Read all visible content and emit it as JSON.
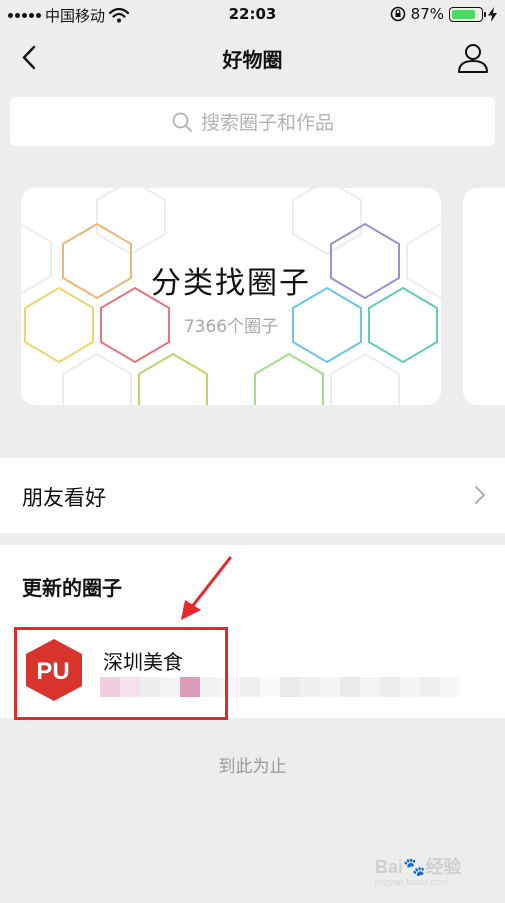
{
  "status_bar": {
    "carrier": "中国移动",
    "time": "22:03",
    "battery_percent": "87%",
    "battery_level": 0.87,
    "icons": [
      "signal-icon",
      "wifi-icon",
      "orientation-lock-icon",
      "battery-icon",
      "charging-icon"
    ]
  },
  "nav": {
    "title": "好物圈",
    "back_icon": "chevron-left-icon",
    "profile_icon": "person-icon"
  },
  "search": {
    "placeholder": "搜索圈子和作品",
    "icon": "search-icon"
  },
  "category_card": {
    "title": "分类找圈子",
    "count": "7366个圈子"
  },
  "friends": {
    "label": "朋友看好",
    "icon": "chevron-right-icon"
  },
  "updates": {
    "title": "更新的圈子",
    "items": [
      {
        "name": "深圳美食",
        "avatar_text": "PU",
        "avatar_color": "#d9342b"
      }
    ]
  },
  "footer": {
    "end_text": "到此为止"
  },
  "watermark": {
    "brand": "Bai",
    "brand_suffix": "经验",
    "url": "jingyan.baidu.com"
  },
  "colors": {
    "background": "#ededed",
    "annotation_red": "#e8272b",
    "battery_green": "#4cd964"
  }
}
